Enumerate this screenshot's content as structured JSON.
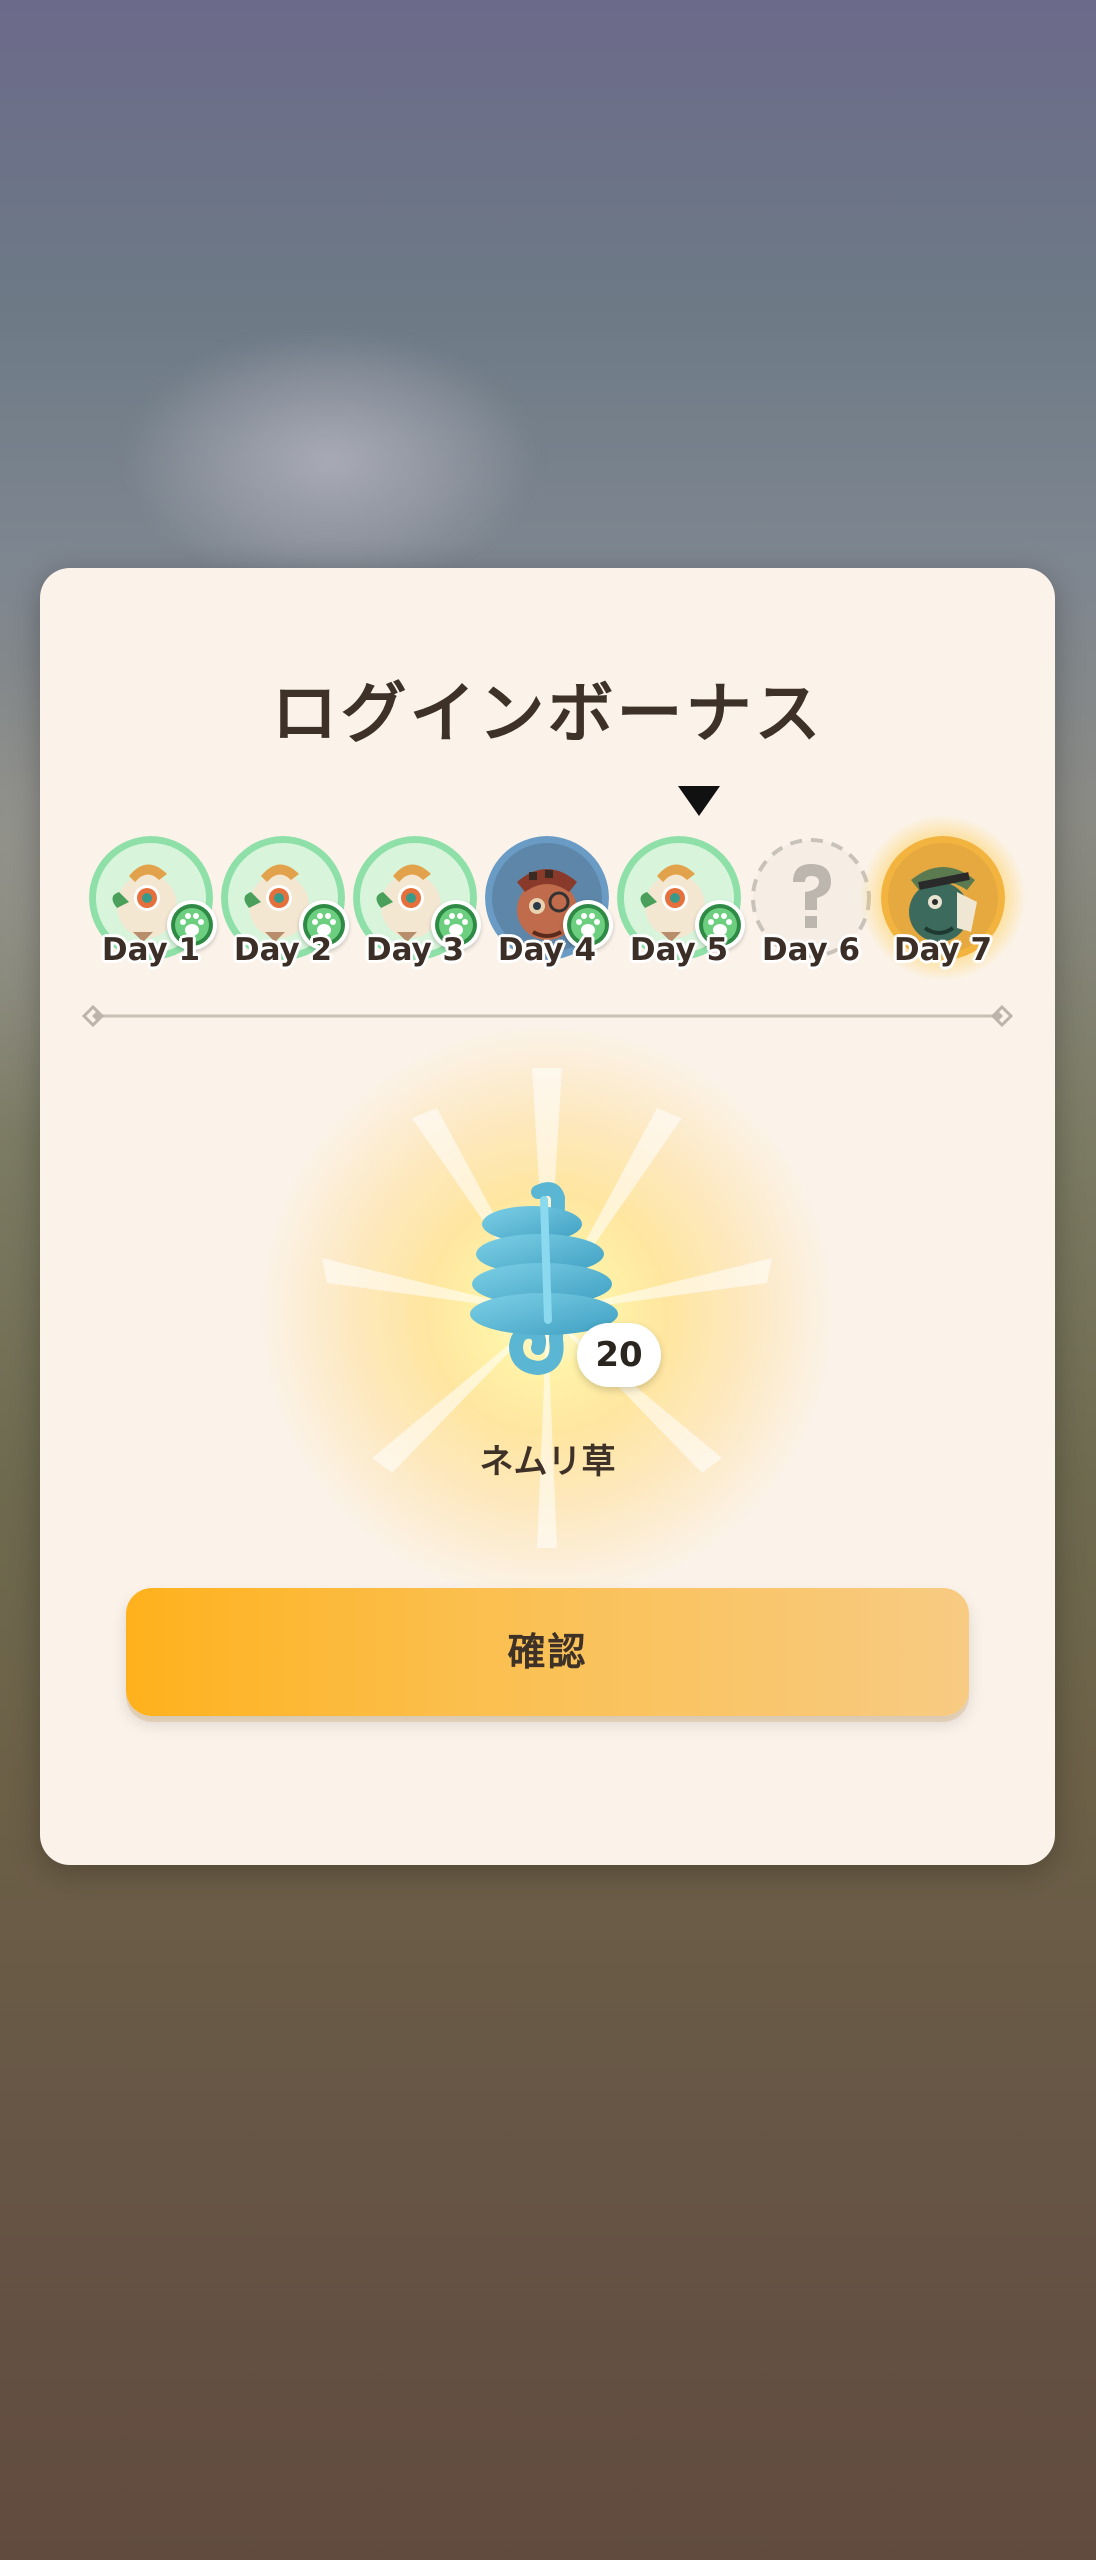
{
  "title": "ログインボーナス",
  "current_day_index": 5,
  "days": [
    {
      "label": "Day 1",
      "reward": "paw-coin",
      "state": "claimed"
    },
    {
      "label": "Day 2",
      "reward": "paw-coin",
      "state": "claimed"
    },
    {
      "label": "Day 3",
      "reward": "paw-coin",
      "state": "claimed"
    },
    {
      "label": "Day 4",
      "reward": "character",
      "state": "claimed"
    },
    {
      "label": "Day 5",
      "reward": "paw-coin",
      "state": "current"
    },
    {
      "label": "Day 6",
      "reward": "mystery",
      "state": "locked"
    },
    {
      "label": "Day 7",
      "reward": "special-character",
      "state": "locked"
    }
  ],
  "reward": {
    "name": "ネムリ草",
    "quantity": "20",
    "icon": "nemuri-herb-icon"
  },
  "confirm_label": "確認",
  "colors": {
    "panel": "#fbf3ea",
    "text": "#3d3128",
    "button_start": "#ffb11c",
    "button_end": "#f8cb83",
    "claimed_ring": "#8fe0a8"
  }
}
